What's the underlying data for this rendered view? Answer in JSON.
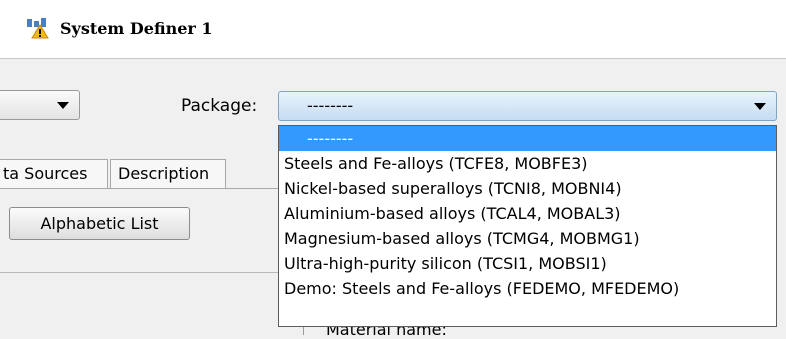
{
  "window": {
    "title": "System Definer 1",
    "icon": "system-definer-icon"
  },
  "toolbar": {
    "package_label": "Package:",
    "package_value": "--------"
  },
  "tabs": [
    {
      "label": "ta Sources"
    },
    {
      "label": "Description"
    }
  ],
  "buttons": {
    "alphabetic_list": "Alphabetic List"
  },
  "panel": {
    "partial_label": "Material name:"
  },
  "dropdown": {
    "selected": "--------",
    "options": [
      "Steels and Fe-alloys (TCFE8, MOBFE3)",
      "Nickel-based superalloys (TCNI8, MOBNI4)",
      "Aluminium-based alloys (TCAL4, MOBAL3)",
      "Magnesium-based alloys (TCMG4, MOBMG1)",
      "Ultra-high-purity silicon (TCSI1, MOBSI1)",
      "Demo: Steels and Fe-alloys (FEDEMO, MFEDEMO)"
    ]
  },
  "colors": {
    "selection": "#3399ff",
    "combo_active": "#c5dcf2"
  }
}
